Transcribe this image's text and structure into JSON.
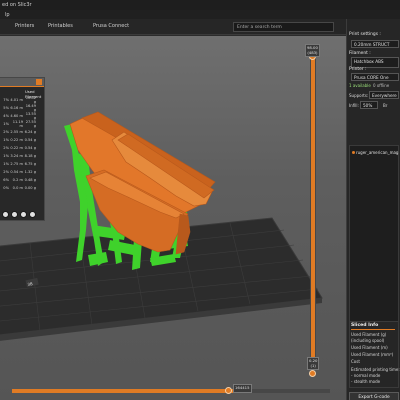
{
  "window": {
    "title": "ed on Slic3r"
  },
  "menu": {
    "visible": "lp"
  },
  "tabs": [
    "Printers",
    "Printables",
    "Prusa Connect"
  ],
  "search": {
    "placeholder": "Enter a search term"
  },
  "gcode_legend": {
    "header": "",
    "columns": [
      "",
      "Used Filament"
    ],
    "rows": [
      {
        "p": "7%",
        "a": "4.01 m",
        "b": "10.82 g"
      },
      {
        "p": "5%",
        "a": "6.16 m",
        "b": "16.49 g"
      },
      {
        "p": "4%",
        "a": "4.60 m",
        "b": "13.55 g"
      },
      {
        "p": "1%",
        "a": "11.19 m",
        "b": "27.55 g"
      },
      {
        "p": "2%",
        "a": "2.55 m",
        "b": "6.24 g"
      },
      {
        "p": "1%",
        "a": "0.22 m",
        "b": "0.54 g"
      },
      {
        "p": "2%",
        "a": "0.22 m",
        "b": "0.54 g"
      },
      {
        "p": "1%",
        "a": "3.24 m",
        "b": "8.18 g"
      },
      {
        "p": "1%",
        "a": "2.75 m",
        "b": "6.75 g"
      },
      {
        "p": "2%",
        "a": "0.54 m",
        "b": "1.32 g"
      },
      {
        "p": "6%",
        "a": "0.2 m",
        "b": "0.48 g"
      },
      {
        "p": "0%",
        "a": "0.0 m",
        "b": "0.00 g"
      }
    ]
  },
  "layer_slider": {
    "top_value": "98.00",
    "top_sub": "(483)",
    "bottom_value": "0.20",
    "bottom_sub": "(1)"
  },
  "move_slider": {
    "value": "164415"
  },
  "sidebar": {
    "print_settings_label": "Print settings :",
    "print_profile": "0.20mm STRUCT",
    "filament_label": "Filament :",
    "filament_profile": "Hatchbox ABS",
    "printer_label": "Printer :",
    "printer_profile": "Prusa CORE One",
    "status_available": "1 available",
    "status_offline": "0 offline",
    "supports_label": "Supports:",
    "supports_value": "Everywhere",
    "infill_label": "Infill:",
    "infill_value": "50%",
    "brim_label": "Br",
    "object_name": "ruger_american_mag",
    "sliced_info": {
      "title": "Sliced Info",
      "lines": [
        "Used Filament (g)",
        "(including spool)",
        "Used Filament (m)",
        "Used Filament (mm³)",
        "Cost",
        "Estimated printing time:",
        "- normal mode",
        "- stealth mode"
      ]
    },
    "export_label": "Export G-code"
  },
  "colors": {
    "accent": "#e07b24",
    "model_orange": "#e2772a",
    "support_green": "#3fd22b",
    "bed": "#2d2d2d"
  },
  "icons": [
    "dropdown-icon",
    "view-iso-icon",
    "view-top-icon",
    "view-front-icon",
    "view-side-icon",
    "edit-icon",
    "object-icon"
  ]
}
